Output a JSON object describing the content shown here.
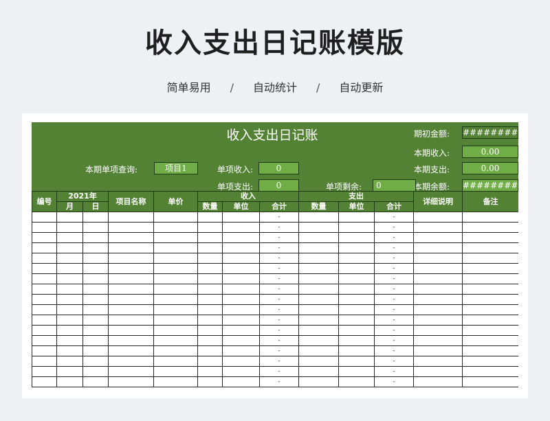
{
  "banner": {
    "title": "收入支出日记账模版",
    "features": [
      "简单易用",
      "自动统计",
      "自动更新"
    ],
    "separator": "/"
  },
  "ledger": {
    "title": "收入支出日记账",
    "period": {
      "opening_label": "期初金额:",
      "opening_value": "#########",
      "income_label": "本期收入:",
      "income_value": "0.00",
      "expense_label": "本期支出:",
      "expense_value": "0.00",
      "balance_label": "本期余额:",
      "balance_value": "#########"
    },
    "query": {
      "label": "本期单项查询:",
      "value": "项目1",
      "item_income_label": "单项收入:",
      "item_income_value": "0",
      "item_expense_label": "单项支出:",
      "item_expense_value": "0",
      "item_balance_label": "单项剩余:",
      "item_balance_value": "0"
    },
    "headers": {
      "no": "编号",
      "year": "2021年",
      "month": "月",
      "day": "日",
      "item_name": "项目名称",
      "unit_price": "单价",
      "income": "收入",
      "expense": "支出",
      "qty": "数量",
      "unit": "单位",
      "total": "合计",
      "detail": "详细说明",
      "remark": "备注"
    },
    "empty_total": "-",
    "row_count": 17
  },
  "colors": {
    "header_green": "#548235",
    "cell_green": "#70ad47"
  }
}
